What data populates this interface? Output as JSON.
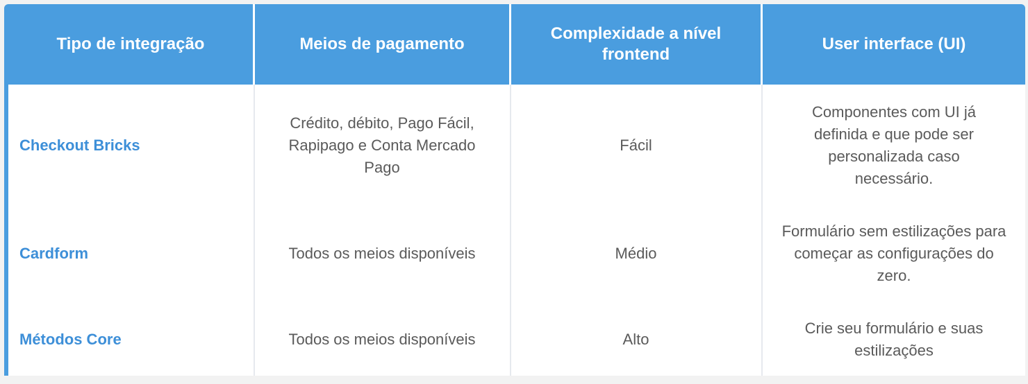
{
  "header": {
    "col1": "Tipo de integração",
    "col2": "Meios de pagamento",
    "col3": "Complexidade a nível frontend",
    "col4": "User interface (UI)"
  },
  "rows": [
    {
      "name": "Checkout Bricks",
      "payment": "Crédito, débito, Pago Fácil, Rapipago e Conta Mercado Pago",
      "complexity": "Fácil",
      "ui": "Componentes com UI já definida e que pode ser personalizada caso necessário."
    },
    {
      "name": "Cardform",
      "payment": "Todos os meios disponíveis",
      "complexity": "Médio",
      "ui": "Formulário sem estilizações para começar as configurações do zero."
    },
    {
      "name": "Métodos Core",
      "payment": "Todos os meios disponíveis",
      "complexity": "Alto",
      "ui": "Crie seu formulário e suas estilizações"
    }
  ],
  "colors": {
    "header_bg": "#4a9ddf",
    "link": "#3d8fd8",
    "text": "#5a5a5a"
  }
}
